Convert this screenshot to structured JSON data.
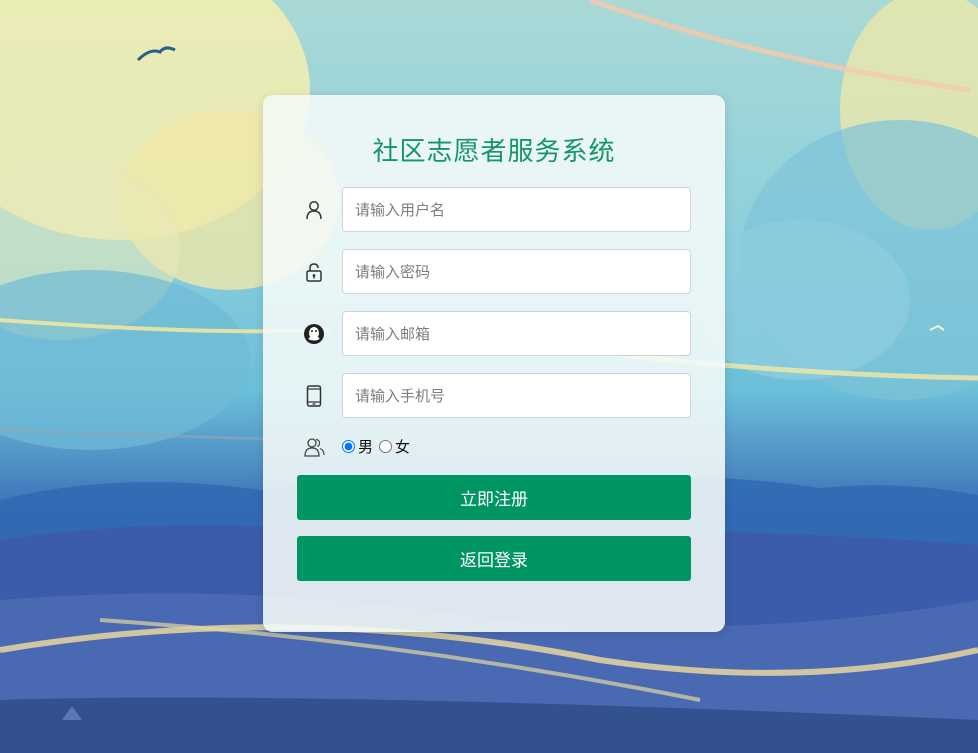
{
  "page": {
    "title": "社区志愿者服务系统"
  },
  "form": {
    "username": {
      "placeholder": "请输入用户名",
      "value": "",
      "icon": "user-icon"
    },
    "password": {
      "placeholder": "请输入密码",
      "value": "",
      "icon": "lock-icon"
    },
    "email": {
      "placeholder": "请输入邮箱",
      "value": "",
      "icon": "qq-penguin-icon"
    },
    "phone": {
      "placeholder": "请输入手机号",
      "value": "",
      "icon": "mobile-phone-icon"
    },
    "gender": {
      "icon": "users-icon",
      "options": [
        {
          "label": "男",
          "selected": true
        },
        {
          "label": "女",
          "selected": false
        }
      ]
    }
  },
  "buttons": {
    "register_label": "立即注册",
    "back_login_label": "返回登录"
  },
  "colors": {
    "accent": "#009664",
    "title": "#16956a"
  }
}
